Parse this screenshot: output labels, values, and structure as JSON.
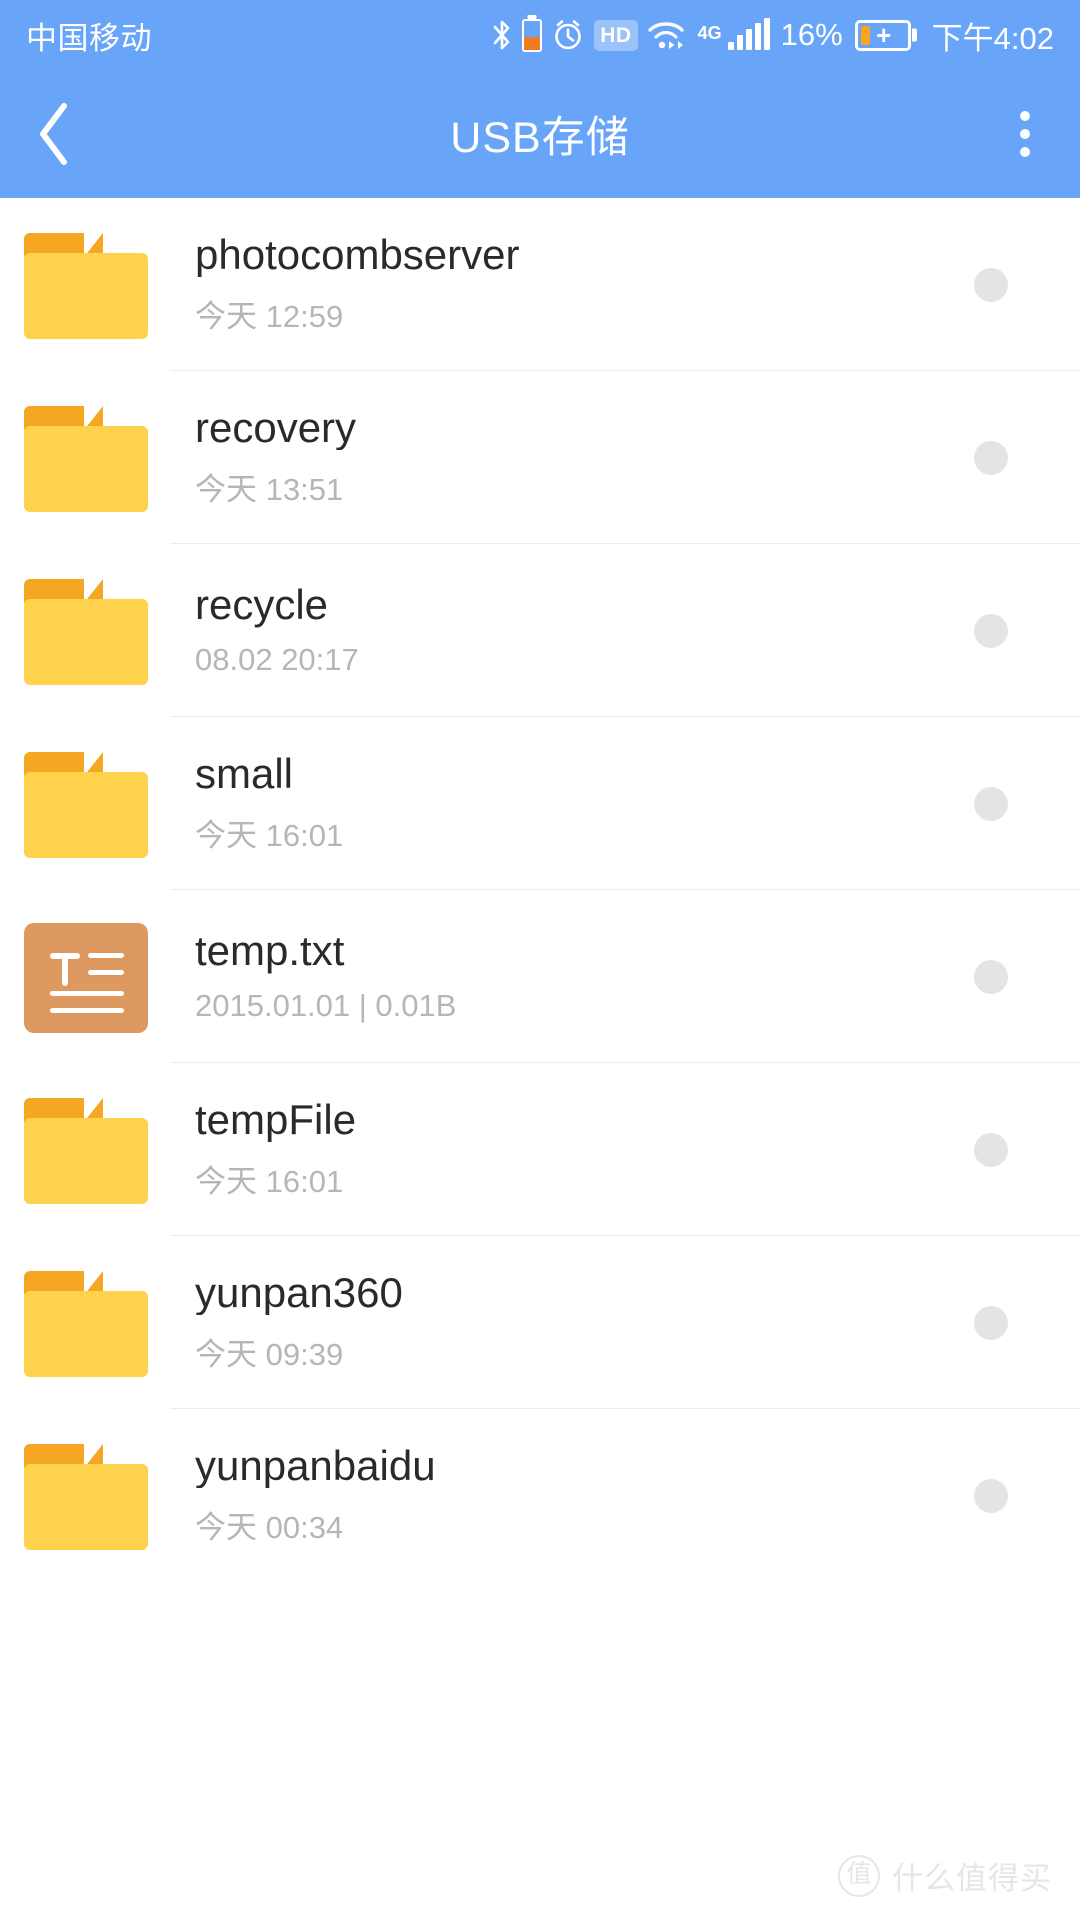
{
  "status_bar": {
    "carrier": "中国移动",
    "battery_percent": "16%",
    "time": "下午4:02",
    "network_type": "4G",
    "hd_badge": "HD",
    "icons": [
      "bluetooth-icon",
      "device-battery-icon",
      "alarm-clock-icon",
      "hd-icon",
      "wifi-icon",
      "signal-bars-icon",
      "battery-charging-icon"
    ]
  },
  "app_bar": {
    "title": "USB存储",
    "back_icon": "chevron-left-icon",
    "overflow_icon": "more-vertical-icon"
  },
  "files": [
    {
      "name": "photocombserver",
      "meta": "今天 12:59",
      "type": "folder"
    },
    {
      "name": "recovery",
      "meta": "今天 13:51",
      "type": "folder"
    },
    {
      "name": "recycle",
      "meta": "08.02 20:17",
      "type": "folder"
    },
    {
      "name": "small",
      "meta": "今天 16:01",
      "type": "folder"
    },
    {
      "name": "temp.txt",
      "meta": "2015.01.01 | 0.01B",
      "type": "text"
    },
    {
      "name": "tempFile",
      "meta": "今天 16:01",
      "type": "folder"
    },
    {
      "name": "yunpan360",
      "meta": "今天 09:39",
      "type": "folder"
    },
    {
      "name": "yunpanbaidu",
      "meta": "今天 00:34",
      "type": "folder"
    }
  ],
  "watermark": {
    "logo": "值",
    "text": "什么值得买"
  },
  "colors": {
    "accent_blue": "#68A4F8",
    "folder_body": "#FFD24D",
    "folder_tab": "#F5A623",
    "txt_icon": "#DD9960",
    "select_dot": "#E4E4E4",
    "battery_orange": "#FBA21E"
  }
}
